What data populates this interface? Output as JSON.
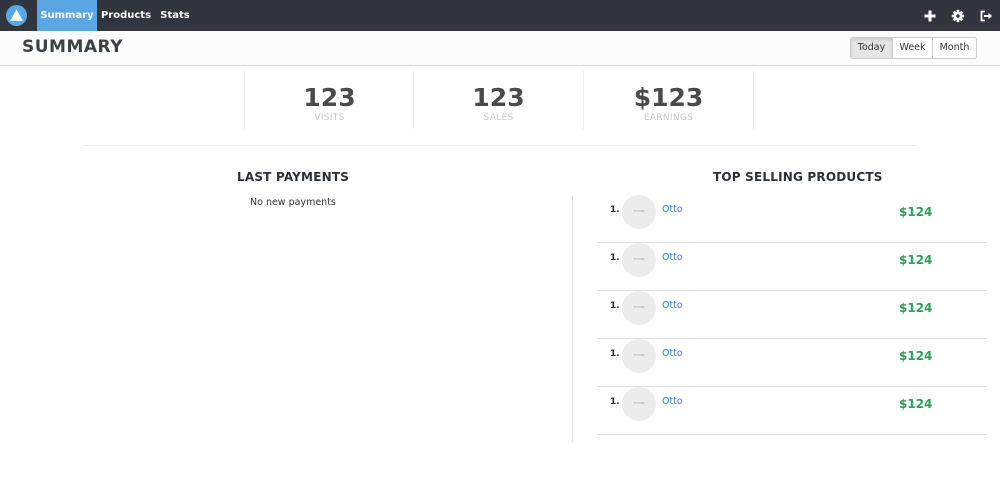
{
  "nav": {
    "tabs": [
      {
        "label": "Summary",
        "active": true
      },
      {
        "label": "Products",
        "active": false
      },
      {
        "label": "Stats",
        "active": false
      }
    ],
    "icons": [
      "plus-icon",
      "gear-icon",
      "sign-out-icon"
    ],
    "accent": "#5aa7e6",
    "background": "#31353d"
  },
  "header": {
    "title": "SUMMARY",
    "ranges": [
      {
        "label": "Today",
        "active": true
      },
      {
        "label": "Week",
        "active": false
      },
      {
        "label": "Month",
        "active": false
      }
    ]
  },
  "stats": [
    {
      "value": "123",
      "label": "VISITS"
    },
    {
      "value": "123",
      "label": "SALES"
    },
    {
      "value": "$123",
      "label": "EARNINGS"
    }
  ],
  "last_payments": {
    "title": "LAST PAYMENTS",
    "empty_message": "No new payments"
  },
  "top_products": {
    "title": "TOP SELLING PRODUCTS",
    "price_color": "#2aa05a",
    "items": [
      {
        "rank": "1.",
        "thumb_text": "THUMB",
        "name": "Otto",
        "price": "$124"
      },
      {
        "rank": "1.",
        "thumb_text": "THUMB",
        "name": "Otto",
        "price": "$124"
      },
      {
        "rank": "1.",
        "thumb_text": "THUMB",
        "name": "Otto",
        "price": "$124"
      },
      {
        "rank": "1.",
        "thumb_text": "THUMB",
        "name": "Otto",
        "price": "$124"
      },
      {
        "rank": "1.",
        "thumb_text": "THUMB",
        "name": "Otto",
        "price": "$124"
      }
    ]
  }
}
